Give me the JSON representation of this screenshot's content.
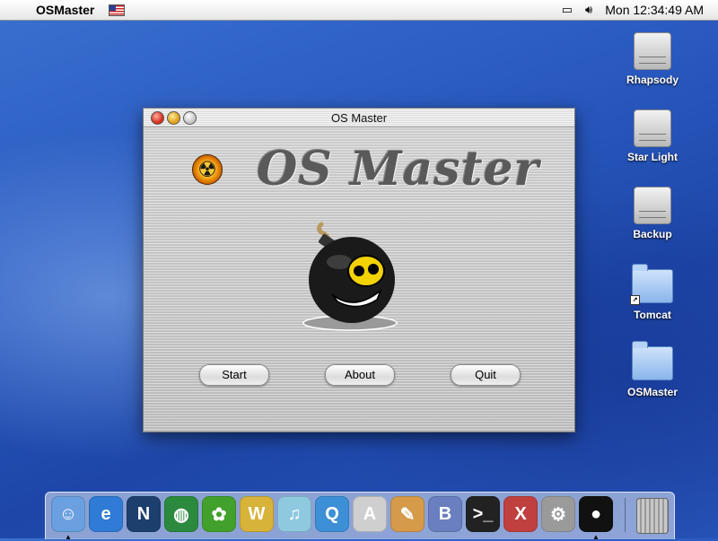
{
  "menubar": {
    "app_name": "OSMaster",
    "clock": "Mon 12:34:49 AM"
  },
  "desktop": {
    "icons": [
      {
        "label": "Rhapsody",
        "kind": "hard-drive"
      },
      {
        "label": "Star Light",
        "kind": "hard-drive"
      },
      {
        "label": "Backup",
        "kind": "hard-drive"
      },
      {
        "label": "Tomcat",
        "kind": "folder-alias"
      },
      {
        "label": "OSMaster",
        "kind": "folder"
      }
    ]
  },
  "window": {
    "title": "OS Master",
    "logo_text": "OS Master",
    "buttons": {
      "start": "Start",
      "about": "About",
      "quit": "Quit"
    }
  },
  "dock": {
    "items": [
      {
        "name": "finder",
        "color": "#6aa0e0"
      },
      {
        "name": "internet-explorer",
        "color": "#2f7bd6"
      },
      {
        "name": "netscape",
        "color": "#1d3f6e"
      },
      {
        "name": "globe",
        "color": "#2b8a3e"
      },
      {
        "name": "icq",
        "color": "#42a12c"
      },
      {
        "name": "www-tool",
        "color": "#d8b33a"
      },
      {
        "name": "itunes",
        "color": "#8fc9e0"
      },
      {
        "name": "quicktime",
        "color": "#3d8fd6"
      },
      {
        "name": "textedit",
        "color": "#cfcfcf"
      },
      {
        "name": "preview",
        "color": "#d59a4a"
      },
      {
        "name": "bbedit",
        "color": "#6a7fc0"
      },
      {
        "name": "terminal",
        "color": "#222222"
      },
      {
        "name": "x11",
        "color": "#c04040"
      },
      {
        "name": "system-prefs",
        "color": "#9a9a9a"
      },
      {
        "name": "osmaster-bomb",
        "color": "#111111"
      }
    ],
    "trash": "trash"
  }
}
